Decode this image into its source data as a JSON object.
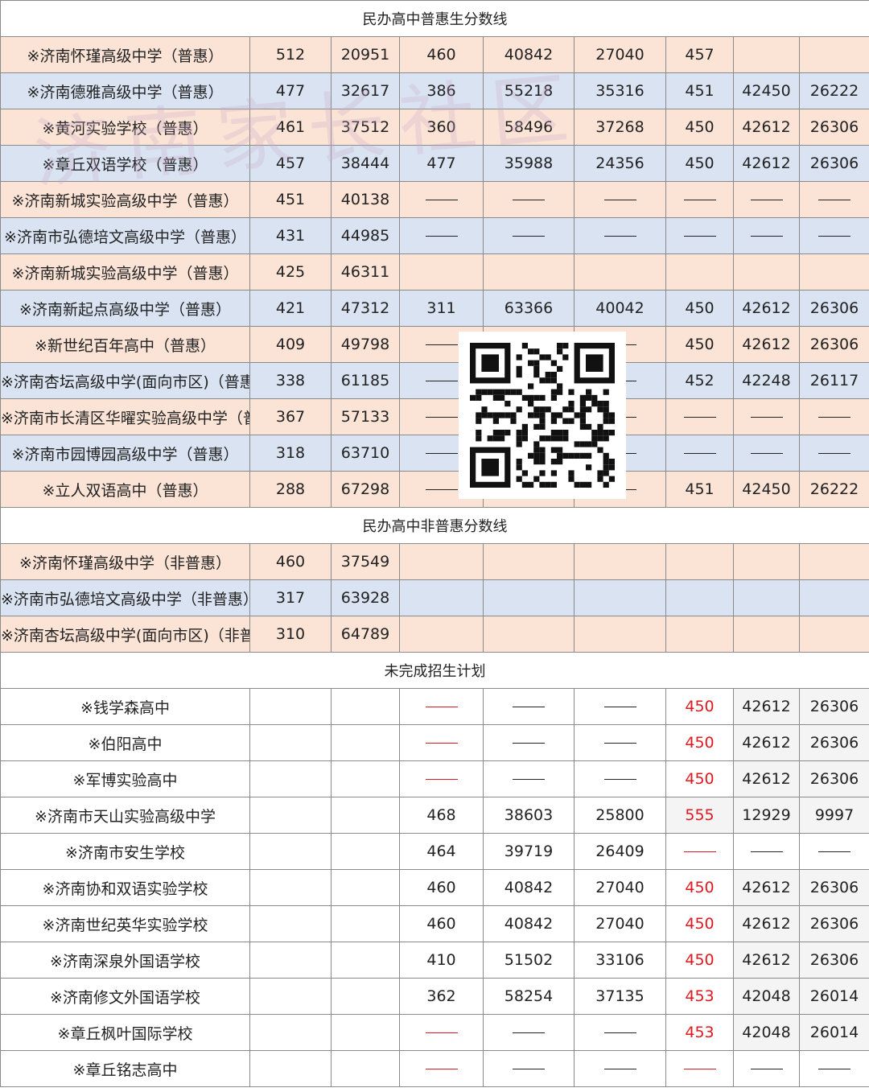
{
  "section_titles": {
    "puhui": "民办高中普惠生分数线",
    "feipuhui": "民办高中非普惠分数线",
    "incomplete": "未完成招生计划"
  },
  "watermark_text": "济南家长社区",
  "qr_label": "qr-code",
  "colors": {
    "peach": "#fbe3d6",
    "blue": "#dae3f2",
    "red": "#e0191f"
  },
  "puhui_rows": [
    {
      "bg": "peach",
      "name": "※济南怀瑾高级中学（普惠）",
      "cells": [
        "512",
        "20951",
        "460",
        "40842",
        "27040",
        "457",
        "",
        ""
      ]
    },
    {
      "bg": "blue",
      "name": "※济南德雅高级中学（普惠）",
      "cells": [
        "477",
        "32617",
        "386",
        "55218",
        "35316",
        "451",
        "42450",
        "26222"
      ]
    },
    {
      "bg": "peach",
      "name": "※黄河实验学校（普惠）",
      "cells": [
        "461",
        "37512",
        "360",
        "58496",
        "37268",
        "450",
        "42612",
        "26306"
      ]
    },
    {
      "bg": "blue",
      "name": "※章丘双语学校（普惠）",
      "cells": [
        "457",
        "38444",
        "477",
        "35988",
        "24356",
        "450",
        "42612",
        "26306"
      ]
    },
    {
      "bg": "peach",
      "name": "※济南新城实验高级中学（普惠）",
      "cells": [
        "451",
        "40138",
        "—",
        "—",
        "—",
        "—",
        "—",
        "—"
      ]
    },
    {
      "bg": "blue",
      "name": "※济南市弘德培文高级中学（普惠）",
      "cells": [
        "431",
        "44985",
        "—",
        "—",
        "—",
        "—",
        "—",
        "—"
      ]
    },
    {
      "bg": "peach",
      "name": "※济南新城实验高级中学（普惠）",
      "cells": [
        "425",
        "46311",
        "",
        "",
        "",
        "",
        "",
        ""
      ]
    },
    {
      "bg": "blue",
      "name": "※济南新起点高级中学（普惠）",
      "cells": [
        "421",
        "47312",
        "311",
        "63366",
        "40042",
        "450",
        "42612",
        "26306"
      ]
    },
    {
      "bg": "peach",
      "name": "※新世纪百年高中（普惠）",
      "cells": [
        "409",
        "49798",
        "—",
        "",
        "—",
        "450",
        "42612",
        "26306"
      ]
    },
    {
      "bg": "blue",
      "name": "※济南杏坛高级中学(面向市区)（普惠）",
      "cells": [
        "338",
        "61185",
        "—",
        "",
        "—",
        "452",
        "42248",
        "26117"
      ]
    },
    {
      "bg": "peach",
      "name": "※济南市长清区华曜实验高级中学（普惠）",
      "cells": [
        "367",
        "57133",
        "—",
        "",
        "—",
        "—",
        "—",
        "—"
      ]
    },
    {
      "bg": "blue",
      "name": "※济南市园博园高级中学（普惠）",
      "cells": [
        "318",
        "63710",
        "—",
        "",
        "—",
        "—",
        "—",
        "—"
      ]
    },
    {
      "bg": "peach",
      "name": "※立人双语高中（普惠）",
      "cells": [
        "288",
        "67298",
        "—",
        "",
        "—",
        "451",
        "42450",
        "26222"
      ]
    }
  ],
  "feipuhui_rows": [
    {
      "bg": "peach",
      "name": "※济南怀瑾高级中学（非普惠）",
      "cells": [
        "460",
        "37549",
        "",
        "",
        "",
        "",
        "",
        ""
      ]
    },
    {
      "bg": "blue",
      "name": "※济南市弘德培文高级中学（非普惠）",
      "cells": [
        "317",
        "63928",
        "",
        "",
        "",
        "",
        "",
        ""
      ]
    },
    {
      "bg": "peach",
      "name": "※济南杏坛高级中学(面向市区)（非普惠）",
      "cells": [
        "310",
        "64789",
        "",
        "",
        "",
        "",
        "",
        ""
      ]
    }
  ],
  "incomplete_rows": [
    {
      "name": "※钱学森高中",
      "cells": [
        "",
        "",
        "—r",
        "—",
        "—",
        "450",
        "42612",
        "26306"
      ]
    },
    {
      "name": "※伯阳高中",
      "cells": [
        "",
        "",
        "—r",
        "—",
        "—",
        "450",
        "42612",
        "26306"
      ]
    },
    {
      "name": "※军博实验高中",
      "cells": [
        "",
        "",
        "—r",
        "—",
        "—",
        "450",
        "42612",
        "26306"
      ]
    },
    {
      "name": "※济南市天山实验高级中学",
      "cells": [
        "",
        "",
        "468",
        "38603",
        "25800",
        "555",
        "12929",
        "9997"
      ]
    },
    {
      "name": "※济南市安生学校",
      "cells": [
        "",
        "",
        "464",
        "39719",
        "26409",
        "—r",
        "—",
        "—"
      ]
    },
    {
      "name": "※济南协和双语实验学校",
      "cells": [
        "",
        "",
        "460",
        "40842",
        "27040",
        "450",
        "42612",
        "26306"
      ]
    },
    {
      "name": "※济南世纪英华实验学校",
      "cells": [
        "",
        "",
        "460",
        "40842",
        "27040",
        "450",
        "42612",
        "26306"
      ]
    },
    {
      "name": "※济南深泉外国语学校",
      "cells": [
        "",
        "",
        "410",
        "51502",
        "33106",
        "450",
        "42612",
        "26306"
      ]
    },
    {
      "name": "※济南修文外国语学校",
      "cells": [
        "",
        "",
        "362",
        "58254",
        "37135",
        "453",
        "42048",
        "26014"
      ]
    },
    {
      "name": "※章丘枫叶国际学校",
      "cells": [
        "",
        "",
        "—r",
        "—",
        "—",
        "453",
        "42048",
        "26014"
      ]
    },
    {
      "name": "※章丘铭志高中",
      "cells": [
        "",
        "",
        "—r",
        "—",
        "—",
        "—r",
        "—",
        "—"
      ]
    }
  ]
}
